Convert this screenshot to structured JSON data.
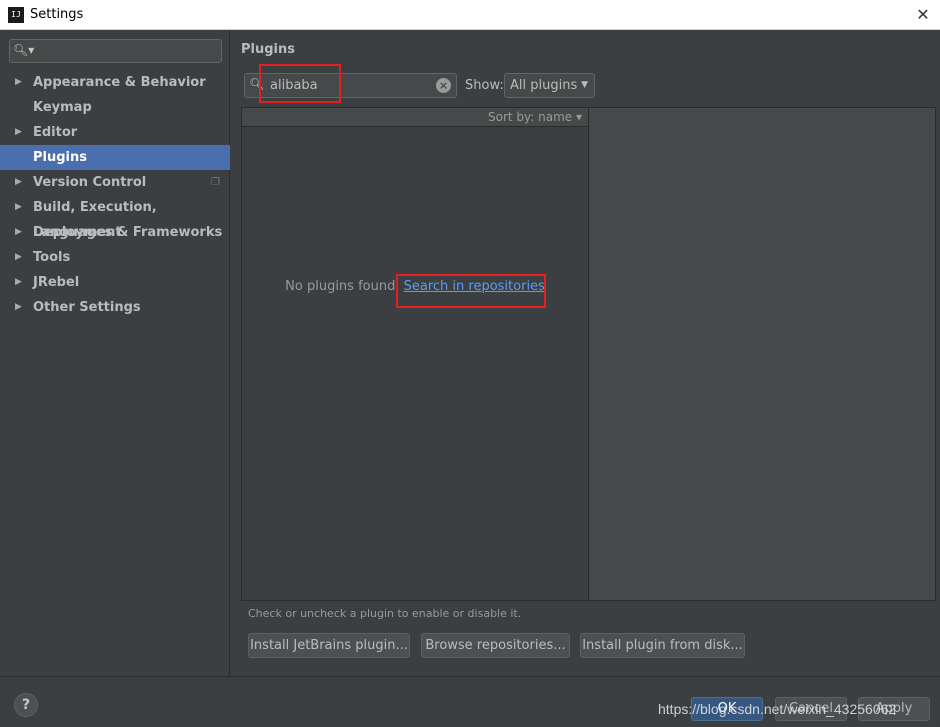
{
  "window": {
    "title": "Settings",
    "app_icon_text": "IJ"
  },
  "sidebar": {
    "search_placeholder": "",
    "items": [
      {
        "label": "Appearance & Behavior",
        "expandable": true
      },
      {
        "label": "Keymap",
        "expandable": false
      },
      {
        "label": "Editor",
        "expandable": true
      },
      {
        "label": "Plugins",
        "expandable": false,
        "selected": true
      },
      {
        "label": "Version Control",
        "expandable": true
      },
      {
        "label": "Build, Execution, Deployment",
        "expandable": true
      },
      {
        "label": "Languages & Frameworks",
        "expandable": true
      },
      {
        "label": "Tools",
        "expandable": true
      },
      {
        "label": "JRebel",
        "expandable": true
      },
      {
        "label": "Other Settings",
        "expandable": true
      }
    ]
  },
  "main": {
    "title": "Plugins",
    "search_value": "alibaba",
    "show_label": "Show:",
    "show_value": "All plugins",
    "sort_label": "Sort by: name",
    "empty_text": "No plugins found.",
    "empty_link": "Search in repositories",
    "hint": "Check or uncheck a plugin to enable or disable it.",
    "buttons": {
      "install_jetbrains": "Install JetBrains plugin...",
      "browse_repos": "Browse repositories...",
      "install_disk": "Install plugin from disk..."
    }
  },
  "footer": {
    "help": "?",
    "ok": "OK",
    "cancel": "Cancel",
    "apply": "Apply",
    "watermark": "https://blog.csdn.net/weixin_43256062"
  },
  "colors": {
    "background": "#3c3f41",
    "selection": "#4b6eaf",
    "link": "#589df6",
    "highlight": "#e41f1f"
  }
}
